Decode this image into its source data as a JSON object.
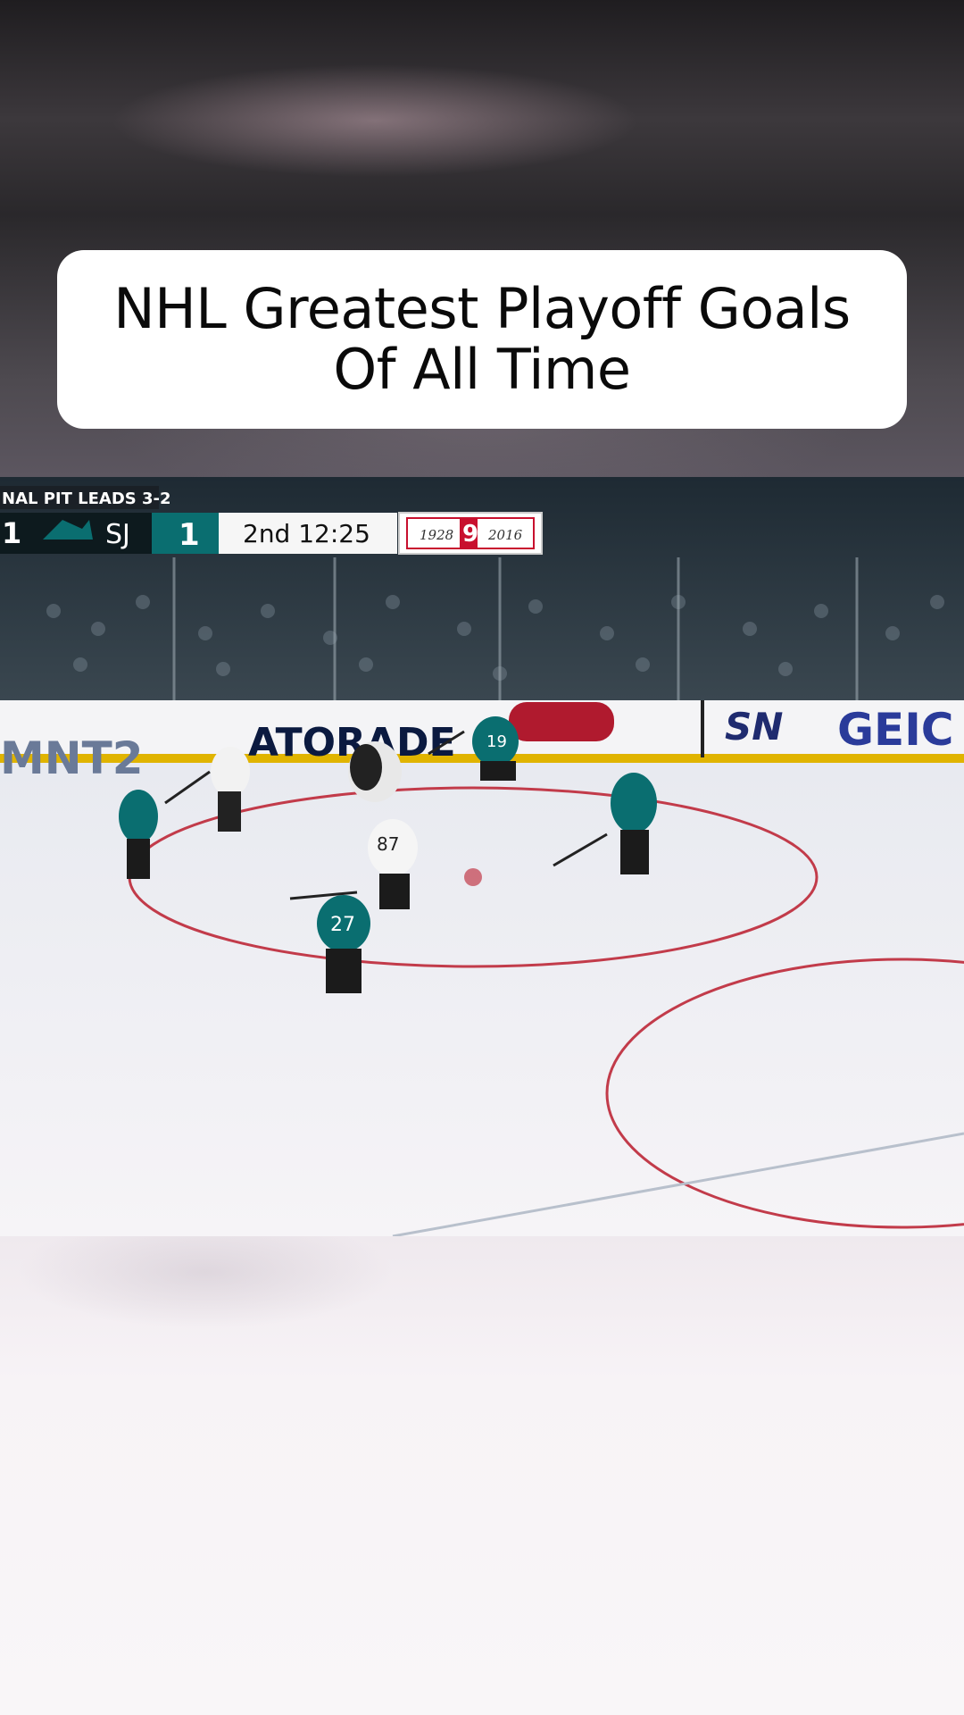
{
  "title": {
    "line1": "NHL Greatest Playoff Goals",
    "line2": "Of All Time"
  },
  "scoreboard": {
    "series_text": "NAL  PIT LEADS 3-2",
    "left_score": "1",
    "team_abbr": "SJ",
    "team_score": "1",
    "clock": "2nd 12:25",
    "cup_left_year": "1928",
    "cup_number": "9",
    "cup_right_year": "2016"
  },
  "boards": {
    "ad_left": "MNT2",
    "ad_gatorade": "ATORADE",
    "ad_sn": "SN",
    "ad_geico": "GEIC"
  },
  "jerseys": {
    "player_a": "87",
    "player_b": "27",
    "player_c": "19"
  },
  "colors": {
    "teal": "#0a6e70",
    "scoreboard_dark": "#0d1a1e",
    "cup_red": "#c8102e",
    "sn_blue": "#1f2b6f"
  }
}
